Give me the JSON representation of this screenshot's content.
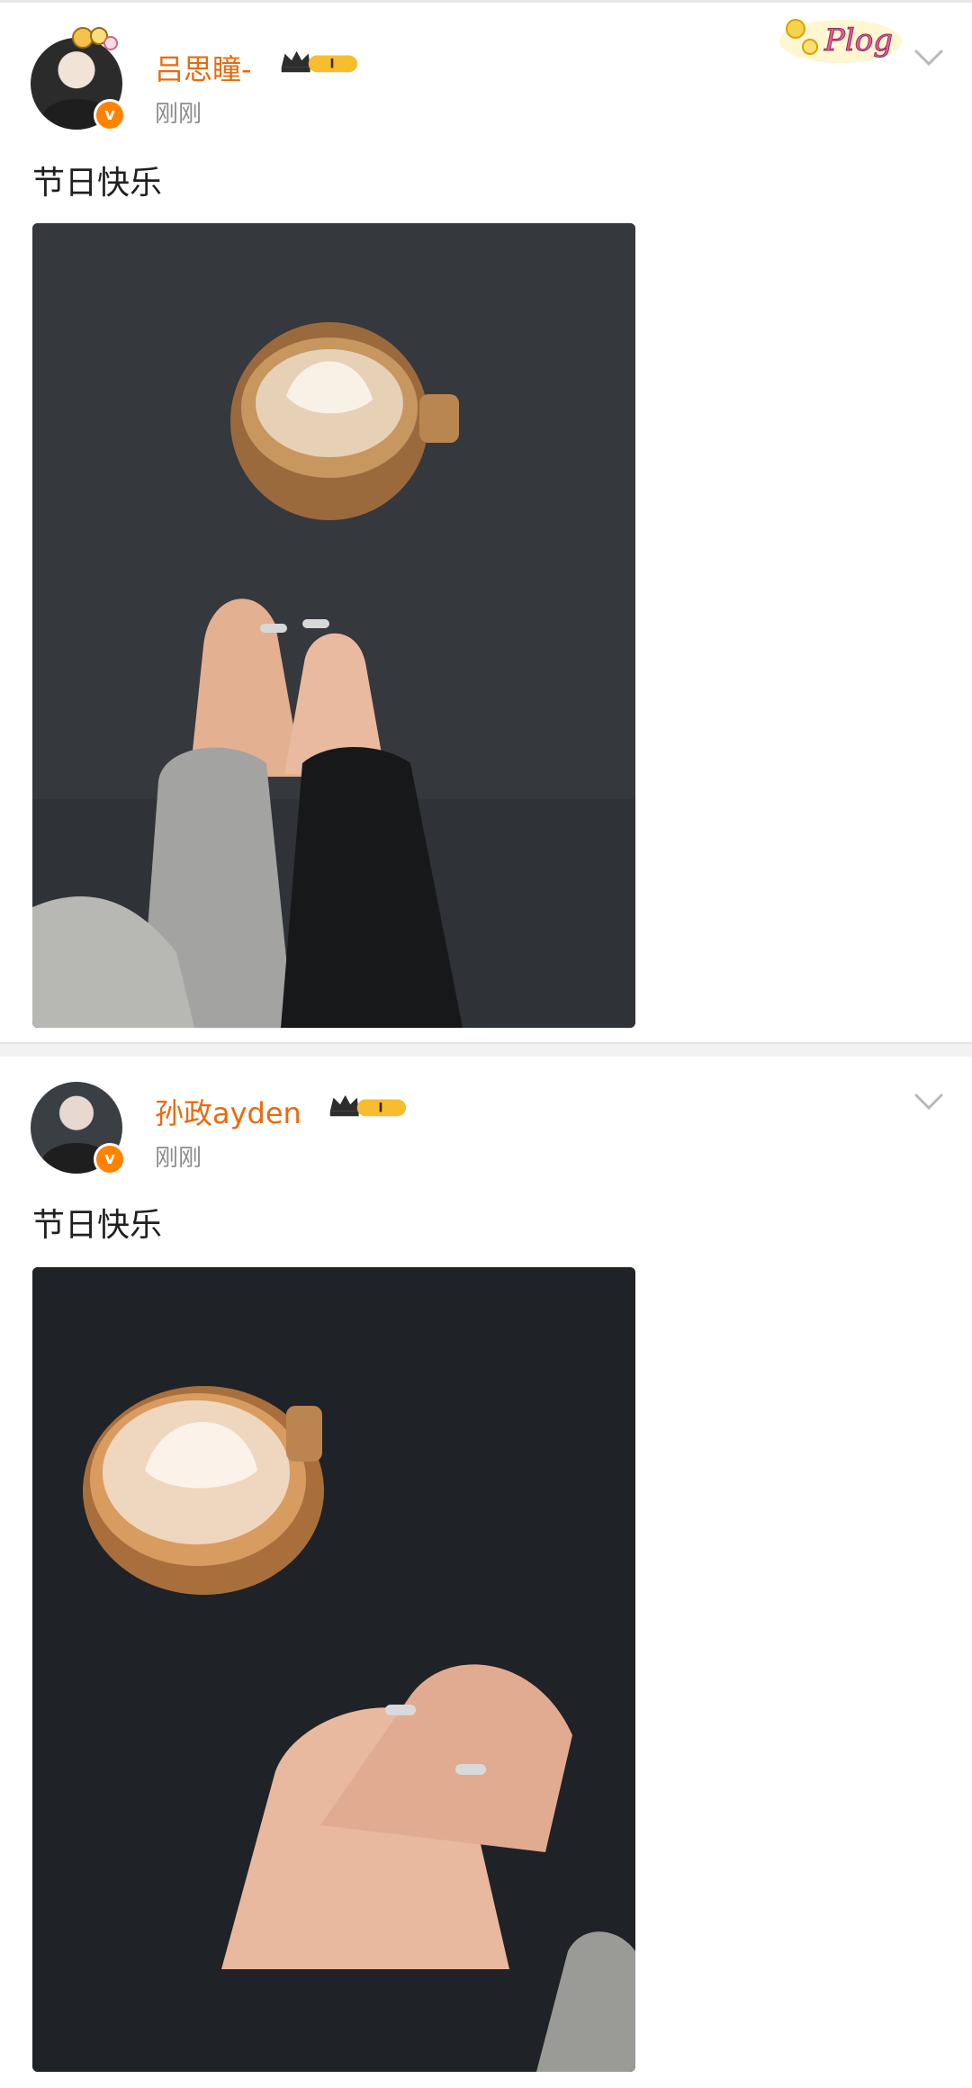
{
  "posts": [
    {
      "username": "吕思瞳-",
      "time": "刚刚",
      "text": "节日快乐",
      "badge_level": "I",
      "has_plog": true,
      "plog_text": "Plog"
    },
    {
      "username": "孙政ayden",
      "time": "刚刚",
      "text": "节日快乐",
      "badge_level": "I",
      "has_plog": false
    }
  ],
  "colors": {
    "username": "#e86b0c",
    "verified": "#ff8200",
    "time": "#8c8c8c",
    "separator": "#f2f2f2"
  },
  "icons": {
    "verified": "verified-v-icon",
    "crown": "crown-icon",
    "menu": "chevron-down-icon"
  }
}
